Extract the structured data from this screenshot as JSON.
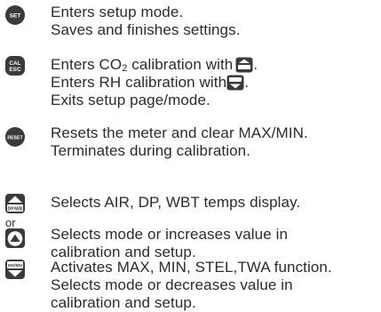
{
  "rows": [
    {
      "icon_label": "SET",
      "lines": [
        "Enters setup mode.",
        "Saves and finishes settings."
      ]
    },
    {
      "icon_label_top": "CAL",
      "icon_label_bottom": "ESC",
      "line1_prefix": "Enters CO",
      "line1_sub": "2",
      "line1_suffix": " calibration with",
      "line1_end": ".",
      "line2_prefix": "Enters RH calibration with",
      "line2_end": ".",
      "line3": "Exits setup page/mode."
    },
    {
      "icon_label": "RESET",
      "lines": [
        "Resets the meter and clear MAX/MIN.",
        "Terminates during calibration."
      ]
    },
    {
      "icon_label": "DP/WB",
      "lines": [
        "Selects AIR, DP, WBT temps display."
      ]
    },
    {
      "or_text": "or"
    },
    {
      "lines": [
        "Selects mode or increases value in",
        "calibration and setup."
      ]
    },
    {
      "icon_label": "MX/MN",
      "lines": [
        "Activates MAX, MIN, STEL,TWA function.",
        "Selects mode or decreases value in",
        "calibration and setup."
      ]
    }
  ],
  "colors": {
    "text": "#2b2b2b",
    "icon_fill": "#3a3a3a",
    "icon_inner": "#ffffff"
  },
  "icons": [
    "set-button-icon",
    "cal-esc-button-icon",
    "reset-button-icon",
    "up-dpwb-button-icon",
    "up-arrow-button-icon",
    "down-maxmin-button-icon"
  ]
}
